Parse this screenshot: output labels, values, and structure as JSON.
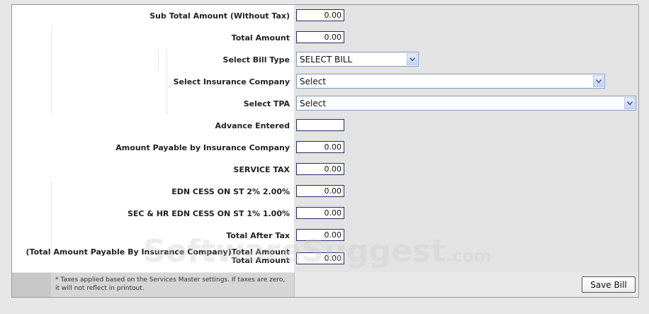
{
  "rows": [
    {
      "label": "Sub Total Amount (Without Tax)",
      "value": "0.00"
    },
    {
      "label": "Total Amount",
      "value": "0.00"
    },
    {
      "label": "Select Bill Type",
      "value": "SELECT BILL"
    },
    {
      "label": "Select Insurance Company",
      "value": "Select"
    },
    {
      "label": "Select TPA",
      "value": "Select"
    },
    {
      "label": "Advance Entered",
      "value": ""
    },
    {
      "label": "Amount Payable by Insurance Company",
      "value": "0.00"
    },
    {
      "label": "SERVICE TAX",
      "value": "0.00"
    },
    {
      "label": "EDN CESS ON ST 2% 2.00%",
      "value": "0.00"
    },
    {
      "label": "SEC & HR EDN CESS ON ST 1% 1.00%",
      "value": "0.00"
    },
    {
      "label": "Total After Tax",
      "value": "0.00"
    },
    {
      "label_line1": "(Total Amount Payable By Insurance Company)Total Amount",
      "label_line2": "Total Amount",
      "value": "0.00"
    }
  ],
  "footer": {
    "note": "* Taxes applied based on the Services Master settings. If taxes are zero, it will not reflect in printout.",
    "save_label": "Save Bill"
  },
  "watermark": {
    "main": "SoftwareSuggest",
    "suffix": ".com"
  },
  "icons": {
    "dropdown": "chevron-down-icon"
  }
}
